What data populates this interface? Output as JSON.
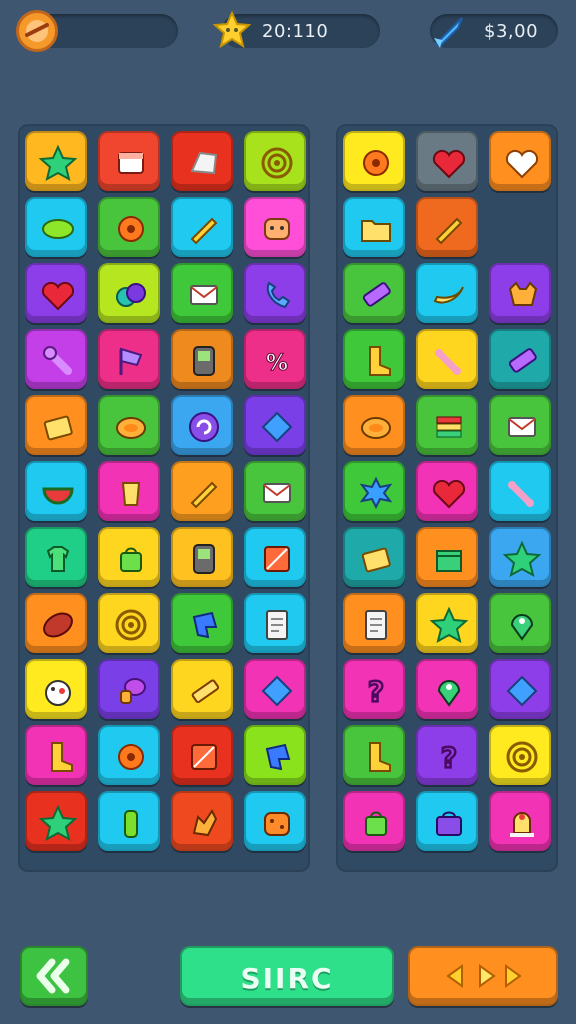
{
  "hud": {
    "timer": "20:110",
    "currency": "$3,00"
  },
  "buttons": {
    "start_label": "SIIRC"
  },
  "colors": {
    "background": "#3e5670",
    "panel": "#314a63",
    "start_button": "#2ee08a",
    "back_button": "#3dc241",
    "arrows_button": "#ff8f1f"
  },
  "left_grid": [
    [
      {
        "color": "#ffb81f",
        "icon": "star"
      },
      {
        "color": "#f0452e",
        "icon": "box"
      },
      {
        "color": "#e9311f",
        "icon": "gem"
      },
      {
        "color": "#a8e21d",
        "icon": "spiral"
      }
    ],
    [
      {
        "color": "#1fc9f0",
        "icon": "lemon"
      },
      {
        "color": "#49c43d",
        "icon": "gear"
      },
      {
        "color": "#1fc9f0",
        "icon": "pencil"
      },
      {
        "color": "#ff4fd8",
        "icon": "face"
      }
    ],
    [
      {
        "color": "#8e3ee8",
        "icon": "heart"
      },
      {
        "color": "#b5e620",
        "icon": "orbs"
      },
      {
        "color": "#3fc93a",
        "icon": "envelope"
      },
      {
        "color": "#8e3ee8",
        "icon": "phone"
      }
    ],
    [
      {
        "color": "#c43fe8",
        "icon": "wrench"
      },
      {
        "color": "#ee2f8a",
        "icon": "flag"
      },
      {
        "color": "#ef8a1f",
        "icon": "phone-box"
      },
      {
        "color": "#ee2f8a",
        "icon": "percent"
      }
    ],
    [
      {
        "color": "#ff8f1f",
        "icon": "card"
      },
      {
        "color": "#49c43d",
        "icon": "plate"
      },
      {
        "color": "#3ba7f0",
        "icon": "swirl"
      },
      {
        "color": "#7b3fe8",
        "icon": "diamond"
      }
    ],
    [
      {
        "color": "#1fc9f0",
        "icon": "watermelon"
      },
      {
        "color": "#f233b5",
        "icon": "cup"
      },
      {
        "color": "#ff9f1f",
        "icon": "pencil"
      },
      {
        "color": "#49c43d",
        "icon": "envelope"
      }
    ],
    [
      {
        "color": "#1fcf87",
        "icon": "shirt"
      },
      {
        "color": "#ffd61f",
        "icon": "bag"
      },
      {
        "color": "#ffc11f",
        "icon": "phone-box"
      },
      {
        "color": "#1fc9f0",
        "icon": "block"
      }
    ],
    [
      {
        "color": "#ff8f1f",
        "icon": "leaf"
      },
      {
        "color": "#ffd61f",
        "icon": "spiral"
      },
      {
        "color": "#3fc93a",
        "icon": "puzzle"
      },
      {
        "color": "#1fc9f0",
        "icon": "note"
      }
    ],
    [
      {
        "color": "#ffe91f",
        "icon": "bird"
      },
      {
        "color": "#7b3fe8",
        "icon": "mushroom"
      },
      {
        "color": "#ffd61f",
        "icon": "paint"
      },
      {
        "color": "#f233b5",
        "icon": "diamond"
      }
    ],
    [
      {
        "color": "#f233b5",
        "icon": "boot"
      },
      {
        "color": "#1fc9f0",
        "icon": "gear"
      },
      {
        "color": "#e9311f",
        "icon": "block"
      },
      {
        "color": "#8ae21d",
        "icon": "puzzle"
      }
    ],
    [
      {
        "color": "#e9311f",
        "icon": "star"
      },
      {
        "color": "#1fc9f0",
        "icon": "bottle"
      },
      {
        "color": "#ef4a1f",
        "icon": "hand"
      },
      {
        "color": "#1fc9f0",
        "icon": "cookie"
      }
    ]
  ],
  "right_grid": [
    [
      {
        "color": "#ffe91f",
        "icon": "gear"
      },
      {
        "color": "#6a7a85",
        "icon": "heart"
      },
      {
        "color": "#ff8f1f",
        "icon": "heart-white"
      }
    ],
    [
      {
        "color": "#1fc9f0",
        "icon": "folder"
      },
      {
        "color": "#ef6a1f",
        "icon": "pencil"
      },
      {
        "color": "",
        "icon": ""
      }
    ],
    [
      {
        "color": "#49c43d",
        "icon": "eraser"
      },
      {
        "color": "#1fc9f0",
        "icon": "banana"
      },
      {
        "color": "#8e3ee8",
        "icon": "cat"
      }
    ],
    [
      {
        "color": "#3fc93a",
        "icon": "boot"
      },
      {
        "color": "#ffd61f",
        "icon": "bone"
      },
      {
        "color": "#1fa9a9",
        "icon": "eraser"
      }
    ],
    [
      {
        "color": "#ff8f1f",
        "icon": "plate"
      },
      {
        "color": "#49c43d",
        "icon": "stack"
      },
      {
        "color": "#49c43d",
        "icon": "envelope"
      }
    ],
    [
      {
        "color": "#3fc93a",
        "icon": "splat"
      },
      {
        "color": "#f233b5",
        "icon": "heart"
      },
      {
        "color": "#1fc9f0",
        "icon": "bone"
      }
    ],
    [
      {
        "color": "#1fa9a9",
        "icon": "card"
      },
      {
        "color": "#ff8f1f",
        "icon": "gift"
      },
      {
        "color": "#3ba7f0",
        "icon": "star"
      }
    ],
    [
      {
        "color": "#ff8f1f",
        "icon": "note"
      },
      {
        "color": "#ffd61f",
        "icon": "star"
      },
      {
        "color": "#49c43d",
        "icon": "pin"
      }
    ],
    [
      {
        "color": "#f233b5",
        "icon": "question"
      },
      {
        "color": "#f233b5",
        "icon": "pin"
      },
      {
        "color": "#8e3ee8",
        "icon": "diamond"
      }
    ],
    [
      {
        "color": "#49c43d",
        "icon": "boot"
      },
      {
        "color": "#8e3ee8",
        "icon": "question"
      },
      {
        "color": "#ffe91f",
        "icon": "spiral"
      }
    ],
    [
      {
        "color": "#f233b5",
        "icon": "bag"
      },
      {
        "color": "#1fc9f0",
        "icon": "basket"
      },
      {
        "color": "#f233b5",
        "icon": "bell"
      }
    ]
  ]
}
